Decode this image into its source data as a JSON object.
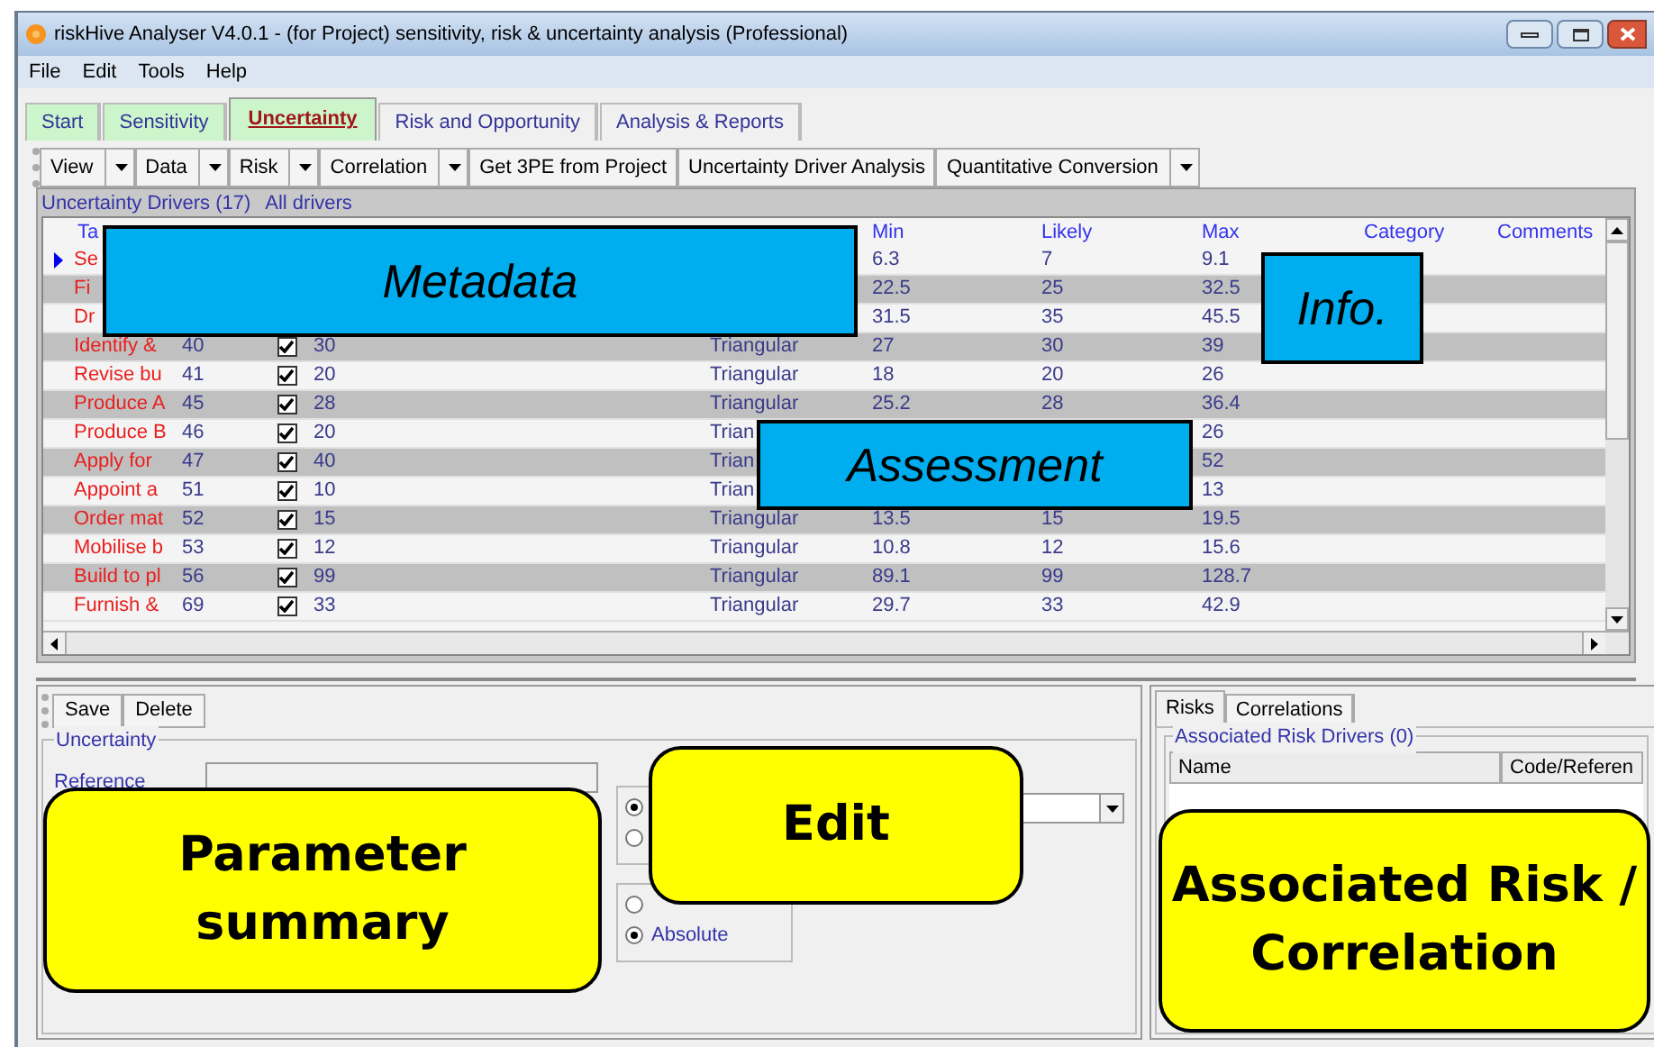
{
  "window": {
    "title": "riskHive Analyser V4.0.1 - (for Project) sensitivity, risk & uncertainty analysis (Professional)"
  },
  "menu": [
    "File",
    "Edit",
    "Tools",
    "Help"
  ],
  "tabs": [
    {
      "label": "Start",
      "selected": false,
      "color": "#ccf5cc"
    },
    {
      "label": "Sensitivity",
      "selected": false,
      "color": "#ccf5cc"
    },
    {
      "label": "Uncertainty",
      "selected": true,
      "color": "#ccf5cc"
    },
    {
      "label": "Risk and Opportunity",
      "selected": false,
      "color": "#f0f0f0"
    },
    {
      "label": "Analysis & Reports",
      "selected": false,
      "color": "#f0f0f0"
    }
  ],
  "toolbar": [
    {
      "label": "View",
      "dropdown": true
    },
    {
      "label": "Data",
      "dropdown": true
    },
    {
      "label": "Risk",
      "dropdown": true
    },
    {
      "label": "Correlation",
      "dropdown": true
    },
    {
      "label": "Get 3PE from Project",
      "dropdown": false
    },
    {
      "label": "Uncertainty Driver Analysis",
      "dropdown": false
    },
    {
      "label": "Quantitative Conversion",
      "dropdown": true
    }
  ],
  "grid": {
    "title": "Uncertainty Drivers (17)",
    "filter": "All drivers",
    "header": {
      "task": "Ta",
      "min": "Min",
      "likely": "Likely",
      "max": "Max",
      "category": "Category",
      "comments": "Comments"
    },
    "rows": [
      {
        "selected": true,
        "task": "Se",
        "min": "6.3",
        "likely": "7",
        "max": "9.1"
      },
      {
        "selected": false,
        "task": "Fi",
        "min": "22.5",
        "likely": "25",
        "max": "32.5"
      },
      {
        "selected": false,
        "task": "Dr",
        "min": "31.5",
        "likely": "35",
        "max": "45.5"
      },
      {
        "selected": false,
        "task": "Identify & ",
        "column_2": "40",
        "checked": true,
        "column_4": "30",
        "column_6": "Triangular",
        "min": "27",
        "likely": "30",
        "max": "39"
      },
      {
        "selected": false,
        "task": "Revise bu",
        "column_2": "41",
        "checked": true,
        "column_4": "20",
        "column_6": "Triangular",
        "min": "18",
        "likely": "20",
        "max": "26"
      },
      {
        "selected": false,
        "task": "Produce A",
        "column_2": "45",
        "checked": true,
        "column_4": "28",
        "column_6": "Triangular",
        "min": "25.2",
        "likely": "28",
        "max": "36.4"
      },
      {
        "selected": false,
        "task": "Produce B",
        "column_2": "46",
        "checked": true,
        "column_4": "20",
        "column_6": "Trian",
        "max": "26"
      },
      {
        "selected": false,
        "task": "Apply for ",
        "column_2": "47",
        "checked": true,
        "column_4": "40",
        "column_6": "Trian",
        "max": "52"
      },
      {
        "selected": false,
        "task": "Appoint a ",
        "column_2": "51",
        "checked": true,
        "column_4": "10",
        "column_6": "Trian",
        "max": "13"
      },
      {
        "selected": false,
        "task": "Order mat",
        "column_2": "52",
        "checked": true,
        "column_4": "15",
        "column_6": "Triangular",
        "min": "13.5",
        "likely": "15",
        "max": "19.5"
      },
      {
        "selected": false,
        "task": "Mobilise b",
        "column_2": "53",
        "checked": true,
        "column_4": "12",
        "column_6": "Triangular",
        "min": "10.8",
        "likely": "12",
        "max": "15.6"
      },
      {
        "selected": false,
        "task": "Build to pl",
        "column_2": "56",
        "checked": true,
        "column_4": "99",
        "column_6": "Triangular",
        "min": "89.1",
        "likely": "99",
        "max": "128.7"
      },
      {
        "selected": false,
        "task": "Furnish & ",
        "column_2": "69",
        "checked": true,
        "column_4": "33",
        "column_6": "Triangular",
        "min": "29.7",
        "likely": "33",
        "max": "42.9"
      }
    ]
  },
  "editor": {
    "buttons": [
      "Save",
      "Delete"
    ],
    "group": "Uncertainty",
    "reference_label": "Reference",
    "radio_group_1": [
      {
        "selected": true
      },
      {
        "selected": false
      }
    ],
    "radio_group_2": [
      {
        "selected": false
      },
      {
        "label": "Absolute",
        "selected": true
      }
    ]
  },
  "side": {
    "tabs": [
      {
        "label": "Risks",
        "selected": true
      },
      {
        "label": "Correlations",
        "selected": false
      }
    ],
    "group": "Associated Risk Drivers (0)",
    "columns": [
      "Name",
      "Code/Referen"
    ]
  },
  "callouts": [
    {
      "kind": "box",
      "text": "Metadata"
    },
    {
      "kind": "box",
      "text": "Info."
    },
    {
      "kind": "box",
      "text": "Assessment"
    },
    {
      "kind": "bubble",
      "text": "Parameter summary"
    },
    {
      "kind": "bubble",
      "text": "Edit"
    },
    {
      "kind": "bubble",
      "text": "Associated Risk / Correlation"
    }
  ]
}
